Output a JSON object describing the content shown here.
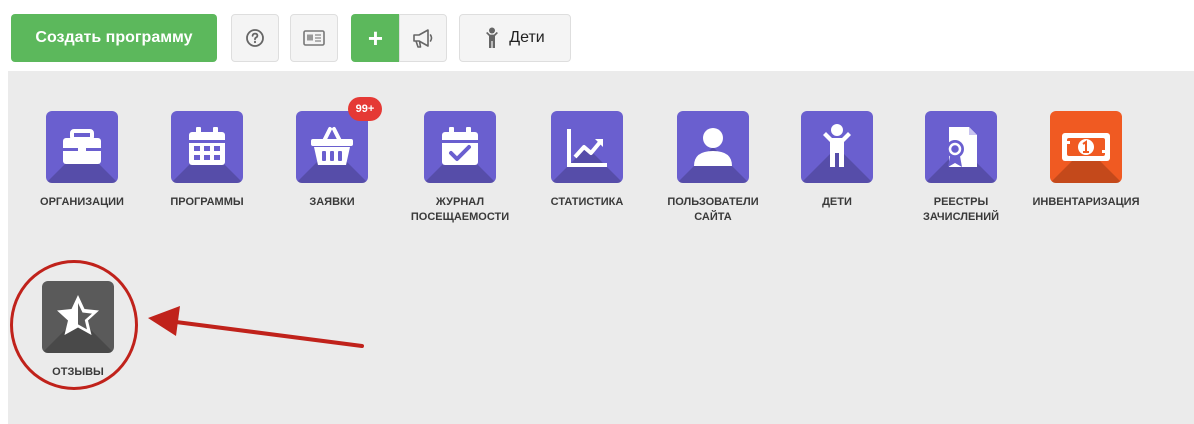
{
  "toolbar": {
    "create_program_label": "Создать программу",
    "plus_label": "+",
    "kids_label": "Дети"
  },
  "tiles": [
    {
      "label_line1": "ОРГАНИЗАЦИИ",
      "label_line2": "",
      "icon": "briefcase-icon",
      "color": "#6a5fcf"
    },
    {
      "label_line1": "ПРОГРАММЫ",
      "label_line2": "",
      "icon": "calendar-icon",
      "color": "#6a5fcf"
    },
    {
      "label_line1": "ЗАЯВКИ",
      "label_line2": "",
      "icon": "basket-icon",
      "color": "#6a5fcf",
      "badge": "99+"
    },
    {
      "label_line1": "ЖУРНАЛ",
      "label_line2": "ПОСЕЩАЕМОСТИ",
      "icon": "calendar-check-icon",
      "color": "#6a5fcf"
    },
    {
      "label_line1": "СТАТИСТИКА",
      "label_line2": "",
      "icon": "chart-line-icon",
      "color": "#6a5fcf"
    },
    {
      "label_line1": "ПОЛЬЗОВАТЕЛИ",
      "label_line2": "САЙТА",
      "icon": "user-icon",
      "color": "#6a5fcf"
    },
    {
      "label_line1": "ДЕТИ",
      "label_line2": "",
      "icon": "child-icon",
      "color": "#6a5fcf"
    },
    {
      "label_line1": "РЕЕСТРЫ",
      "label_line2": "ЗАЧИСЛЕНИЙ",
      "icon": "certificate-doc-icon",
      "color": "#6a5fcf"
    },
    {
      "label_line1": "ИНВЕНТАРИЗАЦИЯ",
      "label_line2": "",
      "icon": "banknote-icon",
      "color": "#f05a22"
    },
    {
      "label_line1": "ОТЗЫВЫ",
      "label_line2": "",
      "icon": "star-icon",
      "color": "#5a5a5a"
    }
  ],
  "colors": {
    "primary_green": "#5cb85c",
    "tile_purple": "#6a5fcf",
    "tile_orange": "#f05a22",
    "tile_gray": "#5a5a5a",
    "badge_red": "#e53935",
    "annotation_red": "#c0221b"
  }
}
